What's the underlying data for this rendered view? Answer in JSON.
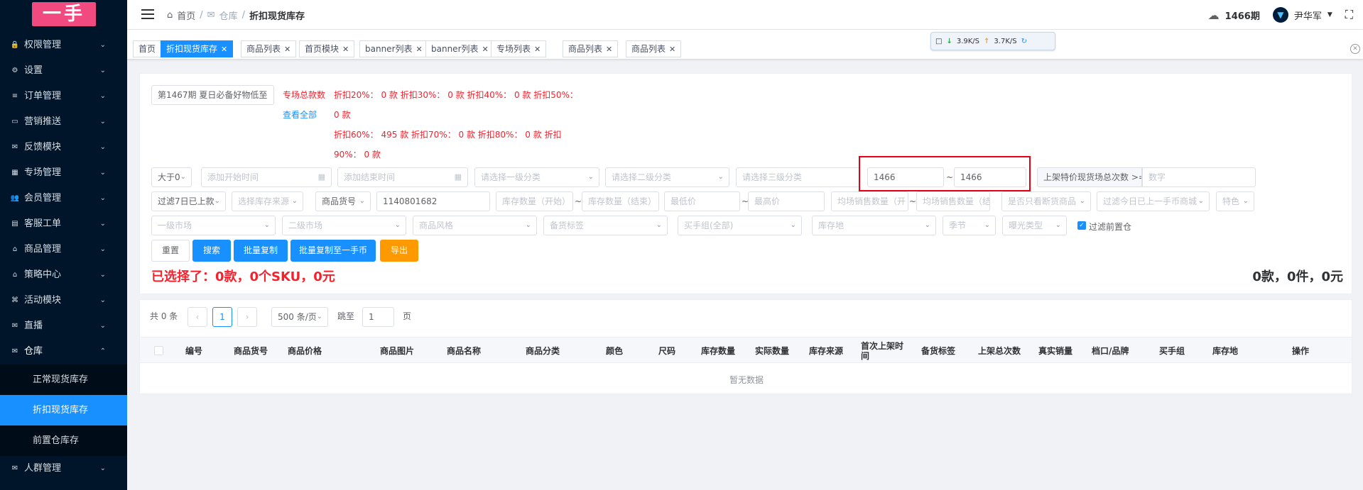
{
  "logo": {
    "text": "一手"
  },
  "sidebar": {
    "items": [
      {
        "icon": "lock-icon",
        "glyph": "🔒",
        "label": "权限管理"
      },
      {
        "icon": "gear-icon",
        "glyph": "⚙",
        "label": "设置"
      },
      {
        "icon": "list-icon",
        "glyph": "≡",
        "label": "订单管理"
      },
      {
        "icon": "card-icon",
        "glyph": "▭",
        "label": "营销推送"
      },
      {
        "icon": "mail-icon",
        "glyph": "✉",
        "label": "反馈模块"
      },
      {
        "icon": "grid-icon",
        "glyph": "▦",
        "label": "专场管理"
      },
      {
        "icon": "users-icon",
        "glyph": "👥",
        "label": "会员管理"
      },
      {
        "icon": "ticket-icon",
        "glyph": "▤",
        "label": "客服工单"
      },
      {
        "icon": "shirt-icon",
        "glyph": "⌂",
        "label": "商品管理"
      },
      {
        "icon": "shirt2-icon",
        "glyph": "⌂",
        "label": "策略中心"
      },
      {
        "icon": "gamepad-icon",
        "glyph": "⌘",
        "label": "活动模块"
      },
      {
        "icon": "broadcast-icon",
        "glyph": "✉",
        "label": "直播"
      },
      {
        "icon": "warehouse-icon",
        "glyph": "✉",
        "label": "仓库"
      }
    ],
    "subitems": [
      "正常现货库存",
      "折扣现货库存",
      "前置仓库存"
    ],
    "last_item": {
      "icon": "people-icon",
      "glyph": "✉",
      "label": "人群管理"
    }
  },
  "breadcrumb": {
    "home": "首页",
    "warehouse": "仓库",
    "current": "折扣现货库存",
    "sep": "/"
  },
  "header": {
    "period": "1466期",
    "user": "尹华军"
  },
  "tabs": [
    "首页",
    "折扣现货库存",
    "商品列表",
    "首页模块",
    "banner列表",
    "banner列表",
    "专场列表",
    "商品列表",
    "商品列表"
  ],
  "net": {
    "down": "3.9K/S",
    "up": "3.7K/S"
  },
  "filter": {
    "period_select": "第1467期 夏日必备好物低至",
    "stats_label": "专场总款数",
    "view_all": "查看全部",
    "stat_line1": "折扣20%： 0 款    折扣30%： 0 款    折扣40%： 0 款    折扣50%：",
    "stat_line2": "0 款",
    "stat_line3": "折扣60%： 495 款    折扣70%： 0 款    折扣80%： 0 款    折扣",
    "stat_line4": "90%： 0 款",
    "gt_select": "大于0",
    "start_time_ph": "添加开始时间",
    "end_time_ph": "添加结束时间",
    "cat1_ph": "请选择一级分类",
    "cat2_ph": "请选择二级分类",
    "cat3_ph": "请选择三级分类",
    "range_from": "1466",
    "range_to": "1466",
    "shelf_label": "上架特价现货场总次数 >=",
    "shelf_ph": "数字",
    "filter7": "过滤7日已上款",
    "stock_src_ph": "选择库存来源",
    "goods_no_select": "商品货号",
    "goods_no_value": "1140801682",
    "stock_start_ph": "库存数量（开始）",
    "stock_end_ph": "库存数量（结束）",
    "min_price_ph": "最低价",
    "max_price_ph": "最高价",
    "avg_sales_start_ph": "均场销售数量（开",
    "avg_sales_end_ph": "均场销售数量（结",
    "only_broken_ph": "是否只看断货商品",
    "filter_today_ph": "过滤今日已上一手币商城",
    "special_ph": "特色",
    "market1_ph": "一级市场",
    "market2_ph": "二级市场",
    "style_ph": "商品风格",
    "stock_tag_ph": "备货标签",
    "buyer_group_ph": "买手组(全部)",
    "location_ph": "库存地",
    "season_ph": "季节",
    "exposure_ph": "曝光类型",
    "filter_pre": "过滤前置仓",
    "tilde": "~"
  },
  "buttons": {
    "reset": "重置",
    "search": "搜索",
    "batch_copy": "批量复制",
    "batch_copy_coin": "批量复制至一手币",
    "export": "导出"
  },
  "selection": {
    "selected": "已选择了：0款，0个SKU，0元",
    "totals": "0款，0件，0元"
  },
  "pager": {
    "total": "共 0 条",
    "page": "1",
    "size": "500 条/页",
    "goto": "跳至",
    "goto_value": "1",
    "page_unit": "页"
  },
  "table": {
    "headers": [
      "编号",
      "商品货号",
      "商品价格",
      "商品图片",
      "商品名称",
      "商品分类",
      "颜色",
      "尺码",
      "库存数量",
      "实际数量",
      "库存来源",
      "首次上架时间",
      "备货标签",
      "上架总次数",
      "真实销量",
      "档口/品牌",
      "买手组",
      "库存地",
      "操作"
    ],
    "empty": "暂无数据"
  }
}
